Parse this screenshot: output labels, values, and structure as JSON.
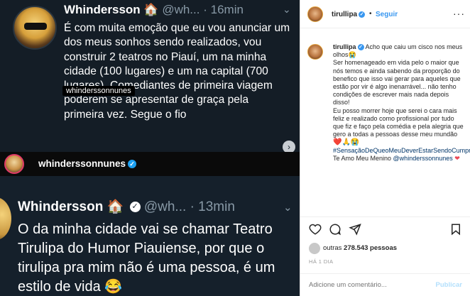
{
  "tweet1": {
    "name": "Whindersson",
    "name_emoji": "🏠",
    "handle": "@wh...",
    "time": "16min",
    "body": "É com muita emoção que eu vou anunciar um dos meus sonhos sendo realizados, vou construir 2 teatros no Piauí, um na minha cidade (100 lugares) e um na capital (700 lugares). Comediantes de primeira viagem poderem se apresentar de graça pela primeira vez. Segue o fio",
    "overlay_tag": "whinderssonnunes"
  },
  "story_bar": {
    "username": "whinderssonnunes"
  },
  "tweet2": {
    "name": "Whindersson",
    "name_emoji": "🏠",
    "handle": "@wh...",
    "time": "13min",
    "body": "O da minha cidade vai se chamar Teatro Tirulipa do Humor Piauiense, por que o tirulipa pra mim não é uma pessoa, é um estilo de vida 😂"
  },
  "instagram": {
    "header": {
      "username": "tirullipa",
      "follow_label": "Seguir",
      "dot": "•",
      "more_icon": "more-icon"
    },
    "caption": {
      "username": "tirullipa",
      "lines": [
        "Acho que caiu um cisco nos meus olhos😭",
        "Ser homenageado em vida pelo o maior que nós temos e ainda sabendo da proporção do benefico que isso vai gerar para aqueles que estão por vir é algo inenarrável... não tenho condições de escrever mais nada depois disso!",
        "Eu posso morrer hoje que serei o cara mais feliz e realizado como profissional por tudo que fiz e faço pela comédia e pela alegria que gero a todas a pessoas desse meu mundão"
      ],
      "emoji_row": "❤️🙏😭",
      "hashtag": "#SensaçãoDeQueoMeuDeverEstarSendoCumprido",
      "after_hashtag": " Te Amo Meu Menino ",
      "mention": "@whinderssonnunes",
      "final_heart": "❤"
    },
    "likes_text_prefix": "outras ",
    "likes_count": "278.543",
    "likes_suffix": " pessoas",
    "time": "HÁ 1 DIA",
    "comment_placeholder": "Adicione um comentário...",
    "publish_label": "Publicar"
  }
}
